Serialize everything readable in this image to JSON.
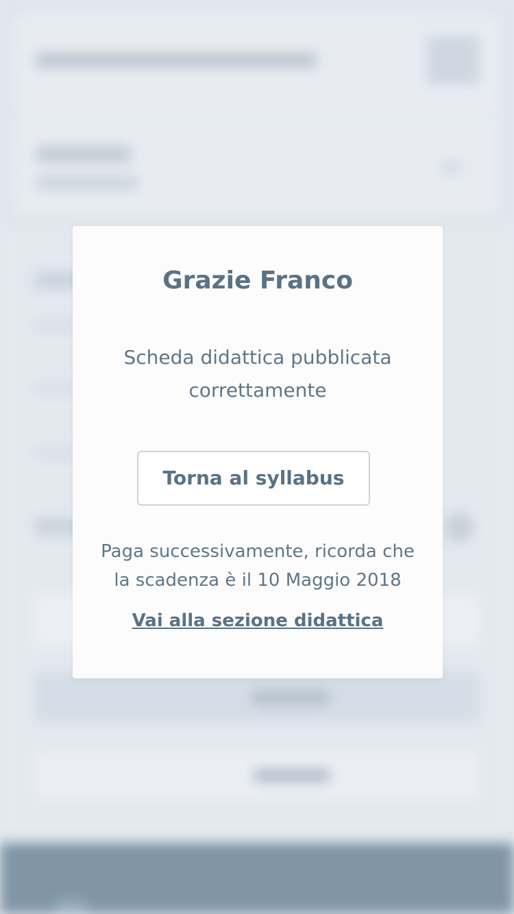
{
  "modal": {
    "title": "Grazie Franco",
    "message": "Scheda didattica pubblicata correttamente",
    "back_button_label": "Torna al syllabus",
    "payment_note": "Paga successivamente, ricorda che la scadenza è il 10 Maggio 2018",
    "section_link_label": "Vai alla sezione didattica"
  },
  "colors": {
    "text_primary": "#5a7284",
    "modal_background": "#fcfcfd",
    "button_border": "#c9d3dc",
    "footer_background": "#6e8799",
    "page_background": "#e4e9ef"
  }
}
